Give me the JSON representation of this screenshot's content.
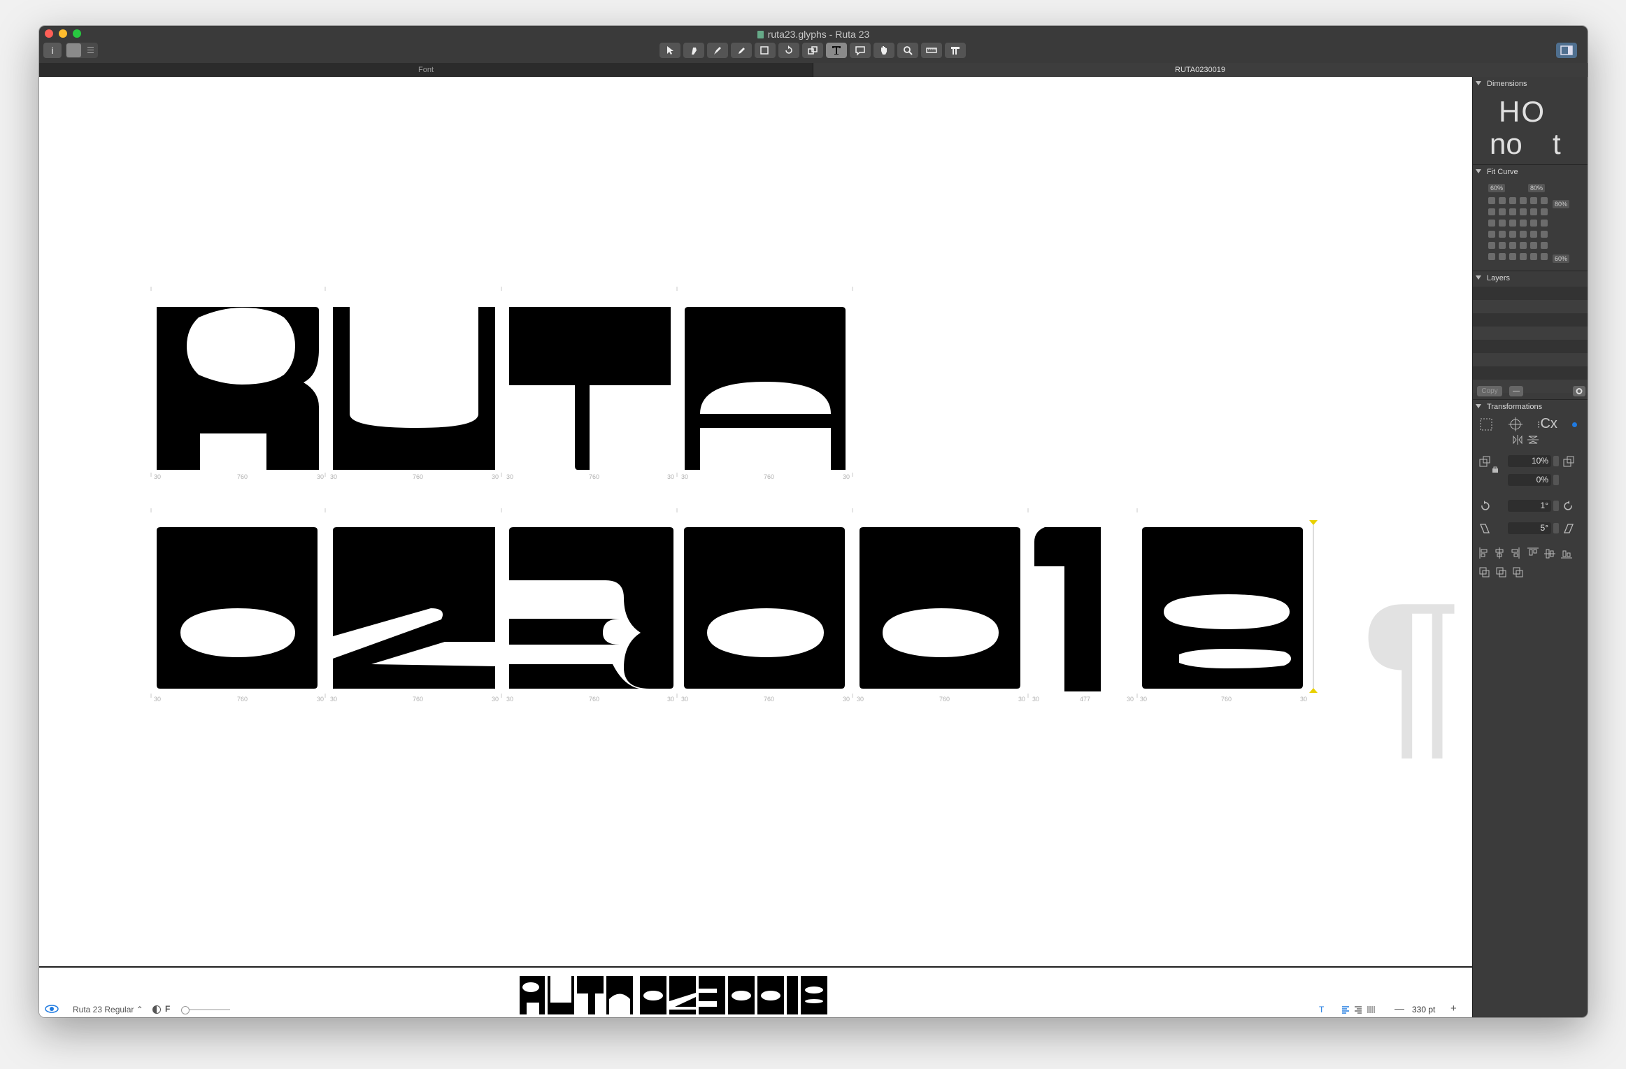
{
  "window": {
    "title": "ruta23.glyphs - Ruta 23"
  },
  "tabs": [
    {
      "label": "Font",
      "active": false
    },
    {
      "label": "RUTA0230019",
      "active": true
    }
  ],
  "toolbar": {
    "info_button": "i",
    "tools": [
      "select-tool",
      "draw-tool",
      "pen-tool",
      "pencil-tool",
      "primitives-tool",
      "rotate-tool",
      "scale-tool",
      "text-tool",
      "annotation-tool",
      "hand-tool",
      "zoom-tool",
      "measure-tool",
      "knife-tool"
    ],
    "active_tool": "text-tool"
  },
  "canvas": {
    "line1": [
      "R",
      "U",
      "T",
      "A"
    ],
    "line2": [
      "0",
      "2",
      "3",
      "0",
      "0",
      "1",
      "9"
    ],
    "sidebearing_label": "30",
    "width_label": "760",
    "one_width_label": "477",
    "paragraph_mark": "¶"
  },
  "panel": {
    "dimensions_title": "Dimensions",
    "dimensions_glyphs_top": "HO",
    "dimensions_glyphs_bottom_left": "no",
    "dimensions_glyphs_bottom_right": "t",
    "fit_curve_title": "Fit Curve",
    "fit_curve_labels": [
      "60%",
      "80%",
      "80%",
      "60%"
    ],
    "layers_title": "Layers",
    "copy_button": "Copy",
    "remove_button": "—",
    "transformations_title": "Transformations",
    "origin_text": "Cx",
    "scale_x": "10%",
    "scale_y": "0%",
    "rotate": "1°",
    "slant": "5°"
  },
  "footer": {
    "font_name": "Ruta 23 Regular",
    "master_letter": "F",
    "zoom": "330 pt",
    "minus": "—",
    "plus": "+"
  },
  "preview_text": "RUTA 0230019"
}
